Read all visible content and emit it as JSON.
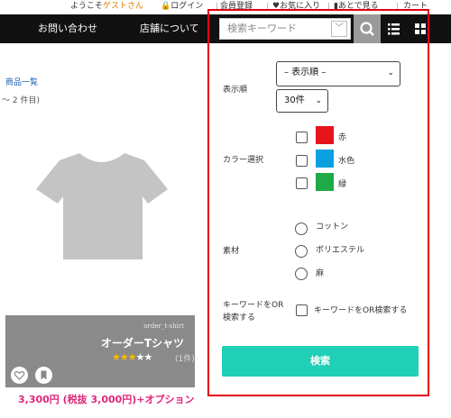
{
  "topbar": {
    "welcome_prefix": "ようこそ",
    "welcome_guest": "ゲストさん",
    "login": "ログイン",
    "register": "会員登録",
    "favorites": "お気に入り",
    "later": "あとで見る",
    "cart": "カート"
  },
  "nav": {
    "contact": "お問い合わせ",
    "store": "店舗について",
    "search_placeholder": "検索キーワード",
    "search_caret": "﹀"
  },
  "listing": {
    "products_link": "商品一覧",
    "count_text": "～ 2 件目)"
  },
  "card": {
    "sku": "order_t-shirt",
    "name": "オーダーTシャツ",
    "rating": 3,
    "rating_max": 5,
    "reviews": "(1件)",
    "price": "3,300円 (税抜 3,000円)+オプション"
  },
  "panel": {
    "sort_label": "表示順",
    "sort_value": "– 表示順 –",
    "per_page_value": "30件",
    "color_label": "カラー選択",
    "colors": [
      {
        "name": "赤",
        "hex": "#e8141c"
      },
      {
        "name": "水色",
        "hex": "#0aa0e0"
      },
      {
        "name": "緑",
        "hex": "#1faa48"
      }
    ],
    "material_label": "素材",
    "materials": [
      "コットン",
      "ポリエステル",
      "麻"
    ],
    "or_label_line1": "キーワードをOR",
    "or_label_line2": "検索する",
    "or_checkbox_text": "キーワードをOR検索する",
    "search_button": "検索"
  },
  "colors": {
    "accent": "#1fcfb6",
    "highlight_border": "#e60012",
    "price": "#e0267a",
    "guest": "#e07a00"
  }
}
